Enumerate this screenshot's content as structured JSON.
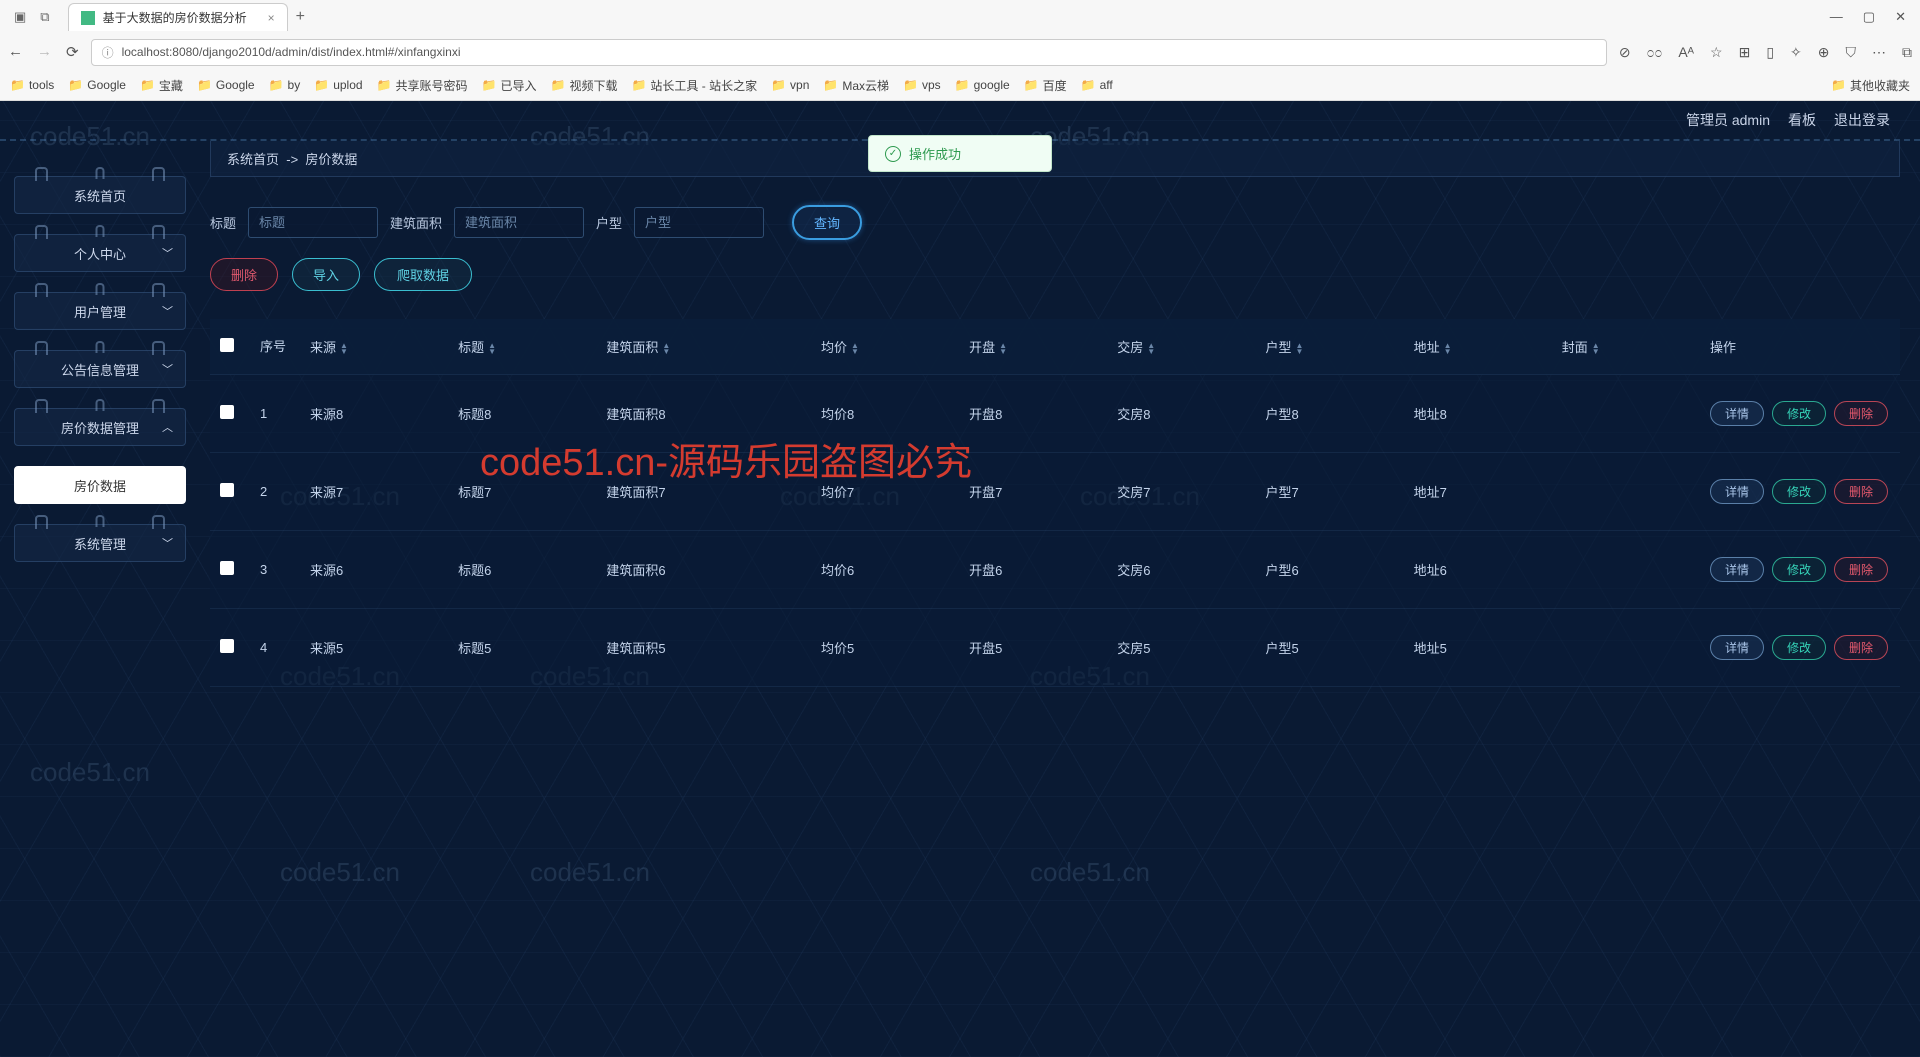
{
  "browser": {
    "tab_title": "基于大数据的房价数据分析",
    "url": "localhost:8080/django2010d/admin/dist/index.html#/xinfangxinxi",
    "bookmarks": [
      "tools",
      "Google",
      "宝藏",
      "Google",
      "by",
      "uplod",
      "共享账号密码",
      "已导入",
      "视频下载",
      "站长工具 - 站长之家",
      "vpn",
      "Max云梯",
      "vps",
      "google",
      "百度",
      "aff"
    ],
    "bookmarks_right": "其他收藏夹"
  },
  "toast": "操作成功",
  "topbar": {
    "admin": "管理员 admin",
    "dashboard": "看板",
    "logout": "退出登录"
  },
  "sidebar": {
    "items": [
      {
        "label": "系统首页",
        "chev": ""
      },
      {
        "label": "个人中心",
        "chev": "﹀"
      },
      {
        "label": "用户管理",
        "chev": "﹀"
      },
      {
        "label": "公告信息管理",
        "chev": "﹀"
      },
      {
        "label": "房价数据管理",
        "chev": "︿"
      },
      {
        "label": "房价数据",
        "chev": "",
        "active": true
      },
      {
        "label": "系统管理",
        "chev": "﹀"
      }
    ]
  },
  "breadcrumb": {
    "home": "系统首页",
    "sep": "->",
    "current": "房价数据"
  },
  "filters": {
    "title_label": "标题",
    "title_ph": "标题",
    "area_label": "建筑面积",
    "area_ph": "建筑面积",
    "hx_label": "户型",
    "hx_ph": "户型",
    "search": "查询"
  },
  "actions": {
    "delete": "删除",
    "import": "导入",
    "crawl": "爬取数据"
  },
  "table": {
    "headers": {
      "seq": "序号",
      "src": "来源",
      "title": "标题",
      "area": "建筑面积",
      "price": "均价",
      "open": "开盘",
      "deliver": "交房",
      "hx": "户型",
      "addr": "地址",
      "cover": "封面",
      "ops": "操作"
    },
    "row_ops": {
      "detail": "详情",
      "edit": "修改",
      "del": "删除"
    },
    "rows": [
      {
        "seq": "1",
        "src": "来源8",
        "title": "标题8",
        "area": "建筑面积8",
        "price": "均价8",
        "open": "开盘8",
        "deliver": "交房8",
        "hx": "户型8",
        "addr": "地址8"
      },
      {
        "seq": "2",
        "src": "来源7",
        "title": "标题7",
        "area": "建筑面积7",
        "price": "均价7",
        "open": "开盘7",
        "deliver": "交房7",
        "hx": "户型7",
        "addr": "地址7"
      },
      {
        "seq": "3",
        "src": "来源6",
        "title": "标题6",
        "area": "建筑面积6",
        "price": "均价6",
        "open": "开盘6",
        "deliver": "交房6",
        "hx": "户型6",
        "addr": "地址6"
      },
      {
        "seq": "4",
        "src": "来源5",
        "title": "标题5",
        "area": "建筑面积5",
        "price": "均价5",
        "open": "开盘5",
        "deliver": "交房5",
        "hx": "户型5",
        "addr": "地址5"
      }
    ]
  },
  "watermark": "code51.cn",
  "big_red": "code51.cn-源码乐园盗图必究"
}
